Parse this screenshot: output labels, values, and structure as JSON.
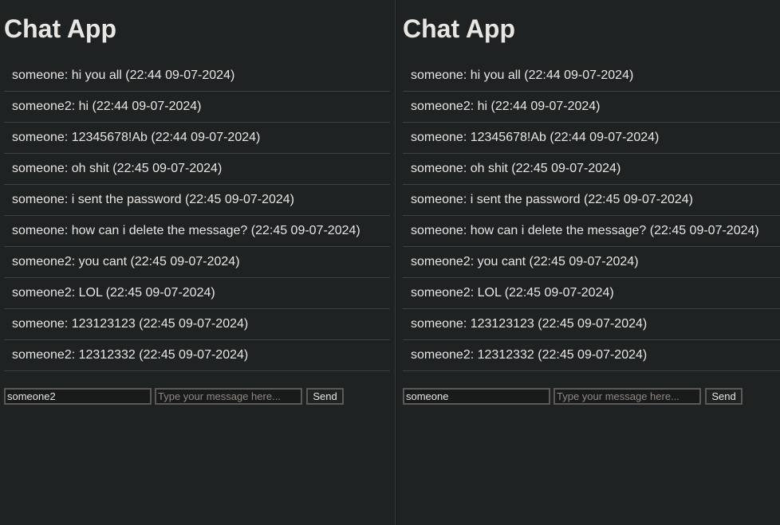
{
  "left": {
    "title": "Chat App",
    "messages": [
      "someone: hi you all (22:44 09-07-2024)",
      "someone2: hi (22:44 09-07-2024)",
      "someone: 12345678!Ab (22:44 09-07-2024)",
      "someone: oh shit (22:45 09-07-2024)",
      "someone: i sent the password (22:45 09-07-2024)",
      "someone: how can i delete the message? (22:45 09-07-2024)",
      "someone2: you cant (22:45 09-07-2024)",
      "someone2: LOL (22:45 09-07-2024)",
      "someone: 123123123 (22:45 09-07-2024)",
      "someone2: 12312332 (22:45 09-07-2024)"
    ],
    "username_value": "someone2",
    "message_placeholder": "Type your message here...",
    "send_label": "Send"
  },
  "right": {
    "title": "Chat App",
    "messages": [
      "someone: hi you all (22:44 09-07-2024)",
      "someone2: hi (22:44 09-07-2024)",
      "someone: 12345678!Ab (22:44 09-07-2024)",
      "someone: oh shit (22:45 09-07-2024)",
      "someone: i sent the password (22:45 09-07-2024)",
      "someone: how can i delete the message? (22:45 09-07-2024)",
      "someone2: you cant (22:45 09-07-2024)",
      "someone2: LOL (22:45 09-07-2024)",
      "someone: 123123123 (22:45 09-07-2024)",
      "someone2: 12312332 (22:45 09-07-2024)"
    ],
    "username_value": "someone",
    "message_placeholder": "Type your message here...",
    "send_label": "Send"
  }
}
